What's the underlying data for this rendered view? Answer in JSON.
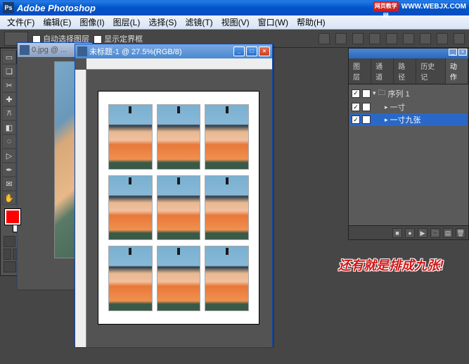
{
  "app": {
    "title": "Adobe Photoshop",
    "watermark_label": "网页教学网",
    "watermark_url": "WWW.WEBJX.COM"
  },
  "menu": {
    "file": "文件(F)",
    "edit": "编辑(E)",
    "image": "图像(I)",
    "layer": "图层(L)",
    "select": "选择(S)",
    "filter": "滤镜(T)",
    "view": "视图(V)",
    "window": "窗口(W)",
    "help": "帮助(H)"
  },
  "options": {
    "auto_select_layer": "自动选择图层",
    "show_bounds": "显示定界框"
  },
  "docs": {
    "d0": {
      "title": "0.jpg @ ..."
    },
    "d1": {
      "title": "未标题-1 @ 27.5%(RGB/8)"
    }
  },
  "panels": {
    "tabs": {
      "layers": "图层",
      "channels": "通道",
      "paths": "路径",
      "history": "历史记",
      "actions": "动作"
    },
    "actions": {
      "set": "序列 1",
      "item1": "一寸",
      "item2": "一寸九张"
    }
  },
  "caption": "还有就是排成九张!",
  "icons": {
    "min": "_",
    "max": "□",
    "close": "×",
    "check": "✓",
    "play": "▶",
    "stop": "■",
    "rec": "●",
    "folder": "📁",
    "trash": "🗑",
    "right": "▸",
    "down": "▾"
  }
}
